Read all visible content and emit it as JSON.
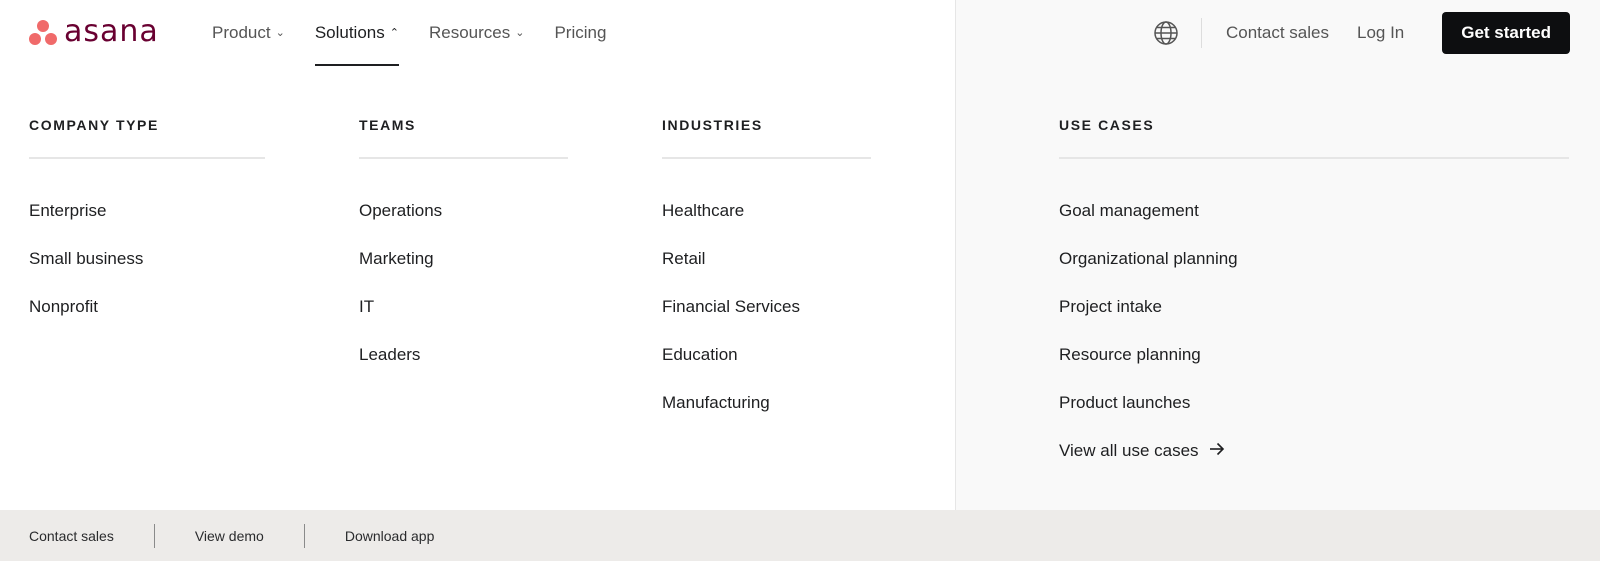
{
  "brand": {
    "name": "asana"
  },
  "nav": {
    "items": [
      {
        "label": "Product",
        "chevron": "chevron-down"
      },
      {
        "label": "Solutions",
        "chevron": "chevron-up",
        "active": true
      },
      {
        "label": "Resources",
        "chevron": "chevron-down"
      },
      {
        "label": "Pricing"
      }
    ]
  },
  "header": {
    "contact_sales": "Contact sales",
    "login": "Log In",
    "get_started": "Get started",
    "globe_icon": "globe-icon"
  },
  "menu": {
    "company_type": {
      "title": "COMPANY TYPE",
      "items": [
        "Enterprise",
        "Small business",
        "Nonprofit"
      ]
    },
    "teams": {
      "title": "TEAMS",
      "items": [
        "Operations",
        "Marketing",
        "IT",
        "Leaders"
      ]
    },
    "industries": {
      "title": "INDUSTRIES",
      "items": [
        "Healthcare",
        "Retail",
        "Financial Services",
        "Education",
        "Manufacturing"
      ]
    },
    "use_cases": {
      "title": "USE CASES",
      "items": [
        "Goal management",
        "Organizational planning",
        "Project intake",
        "Resource planning",
        "Product launches"
      ],
      "view_all": "View all use cases"
    }
  },
  "footer": {
    "items": [
      "Contact sales",
      "View demo",
      "Download app"
    ]
  },
  "colors": {
    "brand_coral": "#f06a6a",
    "brand_text": "#690031",
    "primary_button": "#0d0e10",
    "footer_bg": "#edebe9",
    "right_panel_bg": "#f9f9f9"
  }
}
